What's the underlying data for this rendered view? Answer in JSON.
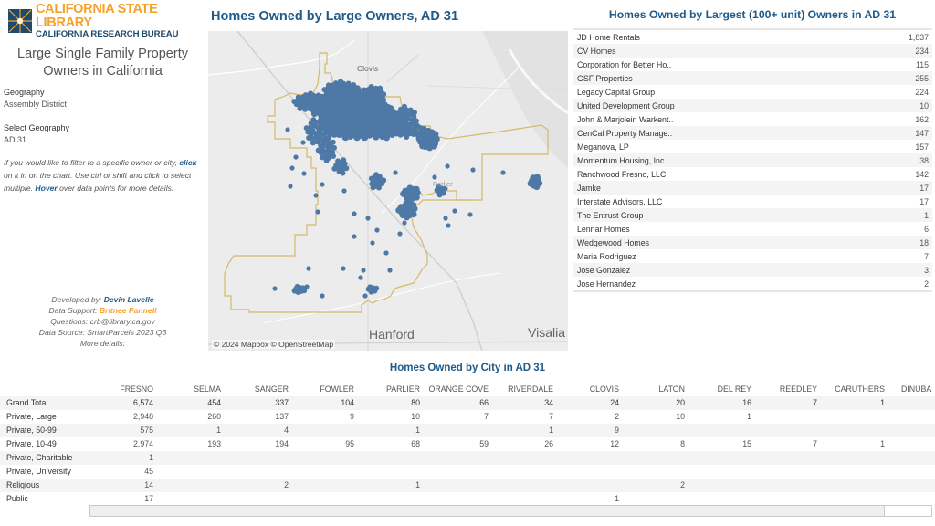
{
  "logo": {
    "line1": "CALIFORNIA STATE LIBRARY",
    "line2": "CALIFORNIA RESEARCH BUREAU",
    "icon": "star-burst-icon",
    "colors": {
      "navy": "#1e4a6e",
      "gold": "#f5a12b"
    }
  },
  "left_panel": {
    "title_line1": "Large Single Family Property",
    "title_line2": "Owners in California",
    "geography": {
      "label": "Geography",
      "value": "Assembly District"
    },
    "select_geography": {
      "label": "Select Geography",
      "value": "AD 31"
    },
    "instructions": {
      "part1": "If you would like to filter to a specific owner or city, ",
      "kw1": "click",
      "part2": "  on it in on the chart. Use ctrl or shift and click to select multiple.  ",
      "kw2": "Hover",
      "part3": " over data points for more details."
    },
    "credits": {
      "developed_label": "Developed by: ",
      "developed_name": "Devin Lavelle",
      "support_label": "Data Support: ",
      "support_name": "Britnee Pannell",
      "questions": "Questions: crb@library.ca.gov",
      "source": "Data Source: SmartParcels 2023 Q3",
      "more": "More details:"
    }
  },
  "map": {
    "title": "Homes Owned by Large Owners, AD 31",
    "attribution": "© 2024 Mapbox © OpenStreetMap",
    "place_labels": {
      "clovis": "Clovis",
      "parlier": "Parlier",
      "hanford": "Hanford",
      "visalia": "Visalia"
    },
    "point_color": "#4e79a7",
    "boundary_color": "#d4b96a"
  },
  "owners": {
    "title": "Homes Owned by Largest (100+ unit) Owners in AD 31",
    "rows": [
      {
        "name": "JD Home Rentals",
        "count": "1,837"
      },
      {
        "name": "CV Homes",
        "count": "234"
      },
      {
        "name": "Corporation for Better Ho..",
        "count": "115"
      },
      {
        "name": "GSF Properties",
        "count": "255"
      },
      {
        "name": "Legacy Capital Group",
        "count": "224"
      },
      {
        "name": "United Development Group",
        "count": "10"
      },
      {
        "name": "John & Marjolein Warkent..",
        "count": "162"
      },
      {
        "name": "CenCal Property Manage..",
        "count": "147"
      },
      {
        "name": "Meganova, LP",
        "count": "157"
      },
      {
        "name": "Momentum Housing, Inc",
        "count": "38"
      },
      {
        "name": "Ranchwood Fresno, LLC",
        "count": "142"
      },
      {
        "name": "Jamke",
        "count": "17"
      },
      {
        "name": "Interstate Advisors, LLC",
        "count": "17"
      },
      {
        "name": "The Entrust Group",
        "count": "1"
      },
      {
        "name": "Lennar Homes",
        "count": "6"
      },
      {
        "name": "Wedgewood Homes",
        "count": "18"
      },
      {
        "name": "Maria Rodriguez",
        "count": "7"
      },
      {
        "name": "Jose Gonzalez",
        "count": "3"
      },
      {
        "name": "Jose Hernandez",
        "count": "2"
      }
    ]
  },
  "city_table": {
    "title": "Homes Owned by City in AD 31",
    "columns": [
      "FRESNO",
      "SELMA",
      "SANGER",
      "FOWLER",
      "PARLIER",
      "ORANGE COVE",
      "RIVERDALE",
      "CLOVIS",
      "LATON",
      "DEL REY",
      "REEDLEY",
      "CARUTHERS",
      "DINUBA"
    ],
    "rows": [
      {
        "label": "Grand Total",
        "values": [
          "6,574",
          "454",
          "337",
          "104",
          "80",
          "66",
          "34",
          "24",
          "20",
          "16",
          "7",
          "1",
          ""
        ]
      },
      {
        "label": "Private, Large",
        "values": [
          "2,948",
          "260",
          "137",
          "9",
          "10",
          "7",
          "7",
          "2",
          "10",
          "1",
          "",
          "",
          ""
        ]
      },
      {
        "label": "Private, 50-99",
        "values": [
          "575",
          "1",
          "4",
          "",
          "1",
          "",
          "1",
          "9",
          "",
          "",
          "",
          "",
          ""
        ]
      },
      {
        "label": "Private, 10-49",
        "values": [
          "2,974",
          "193",
          "194",
          "95",
          "68",
          "59",
          "26",
          "12",
          "8",
          "15",
          "7",
          "1",
          ""
        ]
      },
      {
        "label": "Private, Charitable",
        "values": [
          "1",
          "",
          "",
          "",
          "",
          "",
          "",
          "",
          "",
          "",
          "",
          "",
          ""
        ]
      },
      {
        "label": "Private, University",
        "values": [
          "45",
          "",
          "",
          "",
          "",
          "",
          "",
          "",
          "",
          "",
          "",
          "",
          ""
        ]
      },
      {
        "label": "Religious",
        "values": [
          "14",
          "",
          "2",
          "",
          "1",
          "",
          "",
          "",
          "2",
          "",
          "",
          "",
          ""
        ]
      },
      {
        "label": "Public",
        "values": [
          "17",
          "",
          "",
          "",
          "",
          "",
          "",
          "1",
          "",
          "",
          "",
          "",
          ""
        ]
      }
    ]
  }
}
